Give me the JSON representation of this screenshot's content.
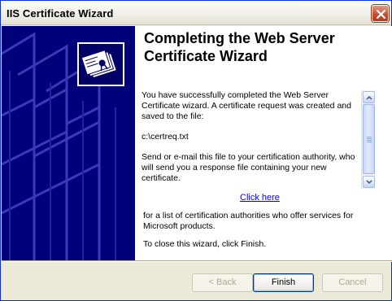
{
  "window": {
    "title": "IIS Certificate Wizard"
  },
  "page": {
    "heading_line1": "Completing the Web Server",
    "heading_line2": "Certificate Wizard",
    "message": {
      "paragraph1": "You have successfully completed the Web Server Certificate wizard. A certificate request was created and saved to the file:",
      "filepath": "c:\\certreq.txt",
      "paragraph2": "Send or e-mail this file to your certification authority, who will send you a response file containing your new certificate."
    },
    "link_text": "Click here",
    "after_link": "for a list of certification authorities who offer services for Microsoft products.",
    "close_note": "To close this wizard, click Finish."
  },
  "buttons": {
    "back": "< Back",
    "finish": "Finish",
    "cancel": "Cancel"
  },
  "colors": {
    "banner": "#00007a",
    "titlebar_close": "#c94a2a",
    "link": "#0000ff"
  }
}
